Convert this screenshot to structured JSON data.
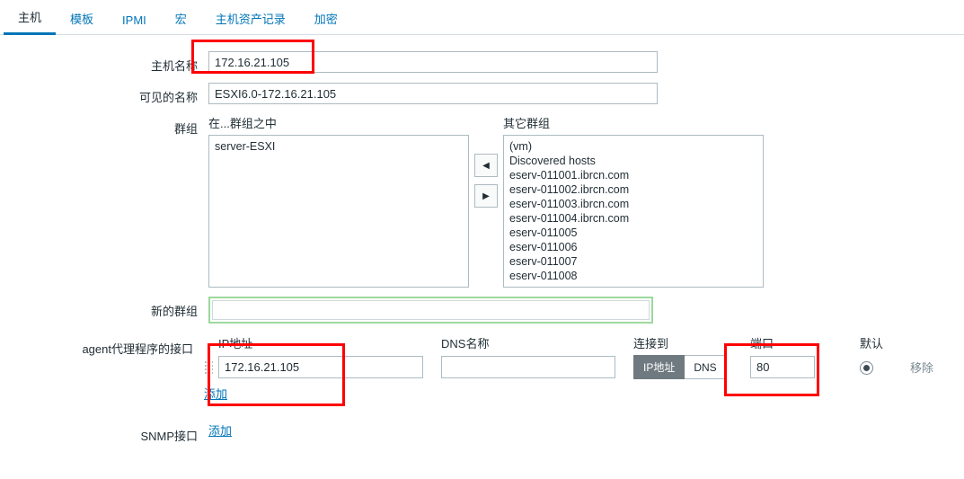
{
  "tabs": [
    {
      "label": "主机"
    },
    {
      "label": "模板"
    },
    {
      "label": "IPMI"
    },
    {
      "label": "宏"
    },
    {
      "label": "主机资产记录"
    },
    {
      "label": "加密"
    }
  ],
  "labels": {
    "host_name": "主机名称",
    "visible_name": "可见的名称",
    "groups": "群组",
    "in_groups": "在...群组之中",
    "other_groups": "其它群组",
    "new_group": "新的群组",
    "agent_interfaces": "agent代理程序的接口",
    "snmp_interfaces": "SNMP接口",
    "ip_address": "IP地址",
    "dns_name": "DNS名称",
    "connect_to": "连接到",
    "port": "端口",
    "default": "默认",
    "btn_ip": "IP地址",
    "btn_dns": "DNS",
    "add": "添加",
    "remove": "移除"
  },
  "form": {
    "host_name": "172.16.21.105",
    "visible_name": "ESXI6.0-172.16.21.105",
    "in_groups": [
      "server-ESXI"
    ],
    "other_groups": [
      "(vm)",
      "Discovered hosts",
      "eserv-011001.ibrcn.com",
      "eserv-011002.ibrcn.com",
      "eserv-011003.ibrcn.com",
      "eserv-011004.ibrcn.com",
      "eserv-011005",
      "eserv-011006",
      "eserv-011007",
      "eserv-011008"
    ],
    "new_group": "",
    "agent_if": {
      "ip": "172.16.21.105",
      "dns": "",
      "connect_to": "ip",
      "port": "80",
      "default": true
    }
  }
}
